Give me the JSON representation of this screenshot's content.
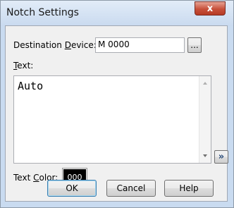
{
  "window": {
    "title": "Notch Settings",
    "close_label": "x"
  },
  "destination": {
    "label_pre": "Destination ",
    "label_mn": "D",
    "label_post": "evice:",
    "value": "M 0000",
    "browse_label": "..."
  },
  "text": {
    "label_mn": "T",
    "label_post": "ext:",
    "value": "Auto",
    "expand_label": "»"
  },
  "text_color": {
    "label_pre": "Text ",
    "label_mn": "C",
    "label_post": "olor:",
    "value": "000",
    "color": "#000000"
  },
  "buttons": {
    "ok": "OK",
    "cancel": "Cancel",
    "help": "Help"
  }
}
